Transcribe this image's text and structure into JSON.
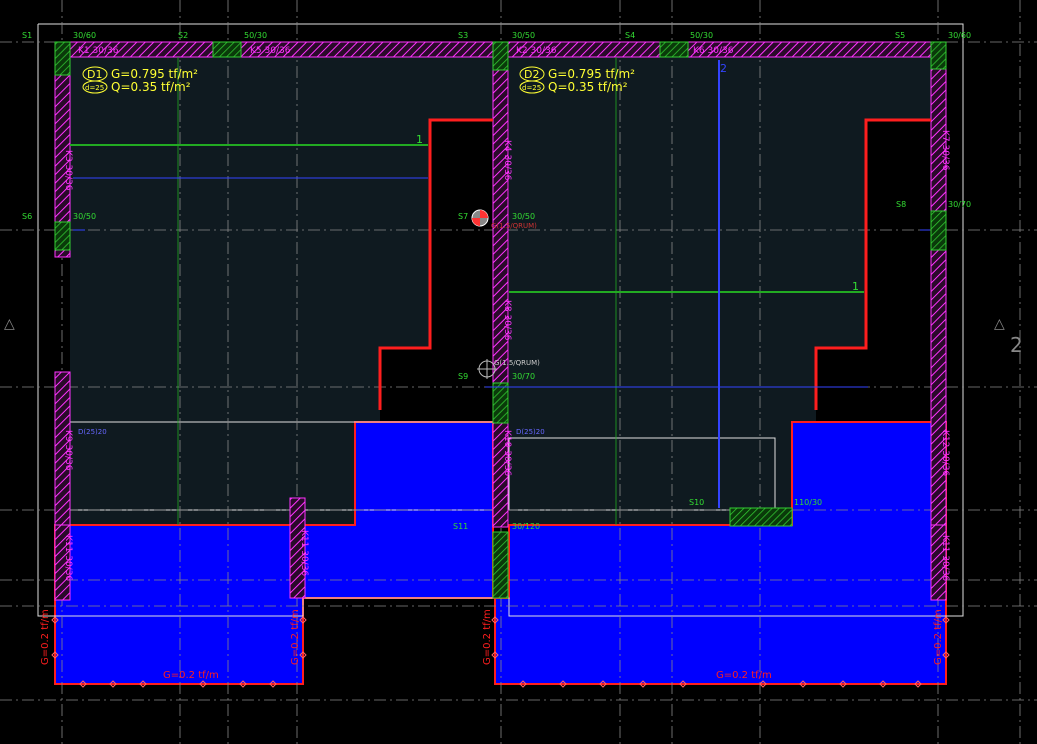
{
  "colors": {
    "background": "#000000",
    "slab": "#0f1a20",
    "beam": "#ff33ff",
    "column_fill": "#1e7a1e",
    "load_fill": "#0000ff",
    "load_border": "#ff1e1e",
    "label_yellow": "#ffff33",
    "label_green": "#33dd33",
    "label_white": "#e0e0e0"
  },
  "axes": {
    "left_marker": "△",
    "right_marker": "△",
    "right_number": "2"
  },
  "columns": {
    "S1": {
      "name": "S1",
      "size": "30/60"
    },
    "S2": {
      "name": "S2",
      "size": "50/30"
    },
    "S3": {
      "name": "S3",
      "size": "30/50"
    },
    "S4": {
      "name": "S4",
      "size": "50/30"
    },
    "S5": {
      "name": "S5",
      "size": "30/60"
    },
    "S6": {
      "name": "S6",
      "size": "30/50"
    },
    "S7": {
      "name": "S7",
      "size": "30/50"
    },
    "S8": {
      "name": "S8",
      "size": "30/70"
    },
    "S9": {
      "name": "S9",
      "size": "30/70"
    },
    "S10": {
      "name": "S10",
      "size": "110/30"
    },
    "S11": {
      "name": "S11",
      "size": "30/120"
    }
  },
  "beams": {
    "k1": "K1 30/36",
    "k2": "K2 30/36",
    "k3": "K3 30/36",
    "k4": "K4 30/36",
    "k5": "K5 30/36",
    "k6": "K6 30/36",
    "k7": "K7 30/36",
    "k8": "K8 30/36",
    "k9": "K9 30/36",
    "k10": "K10 30/36",
    "k11": "K11 30/36",
    "k12": "K12 30/36"
  },
  "slabs": {
    "d1": {
      "name": "D1",
      "thickness": "d=25",
      "g": "G=0.795 tf/m²",
      "q": "Q=0.35 tf/m²"
    },
    "d2": {
      "name": "D2",
      "thickness": "d=25",
      "g": "G=0.795 tf/m²",
      "q": "Q=0.35 tf/m²"
    }
  },
  "loads": {
    "left_side": "G=0.2 tf/m",
    "left_bottom": "G=0.2 tf/m",
    "mid_left": "G=0.2 tf/m",
    "mid_right": "G=0.2 tf/m",
    "right_bottom": "G=0.2 tf/m",
    "right_side": "G=0.2 tf/m"
  },
  "dims": {
    "one_left": "1",
    "one_right": "1",
    "two_top": "2"
  },
  "small_labels": {
    "s7_note": "G(1.5/QRUM)",
    "s9_note": "G(1.5/QRUM)",
    "d1_lower": "D(25)20",
    "d2_lower": "D(25)20",
    "s11_beam": "K11 30/36"
  }
}
